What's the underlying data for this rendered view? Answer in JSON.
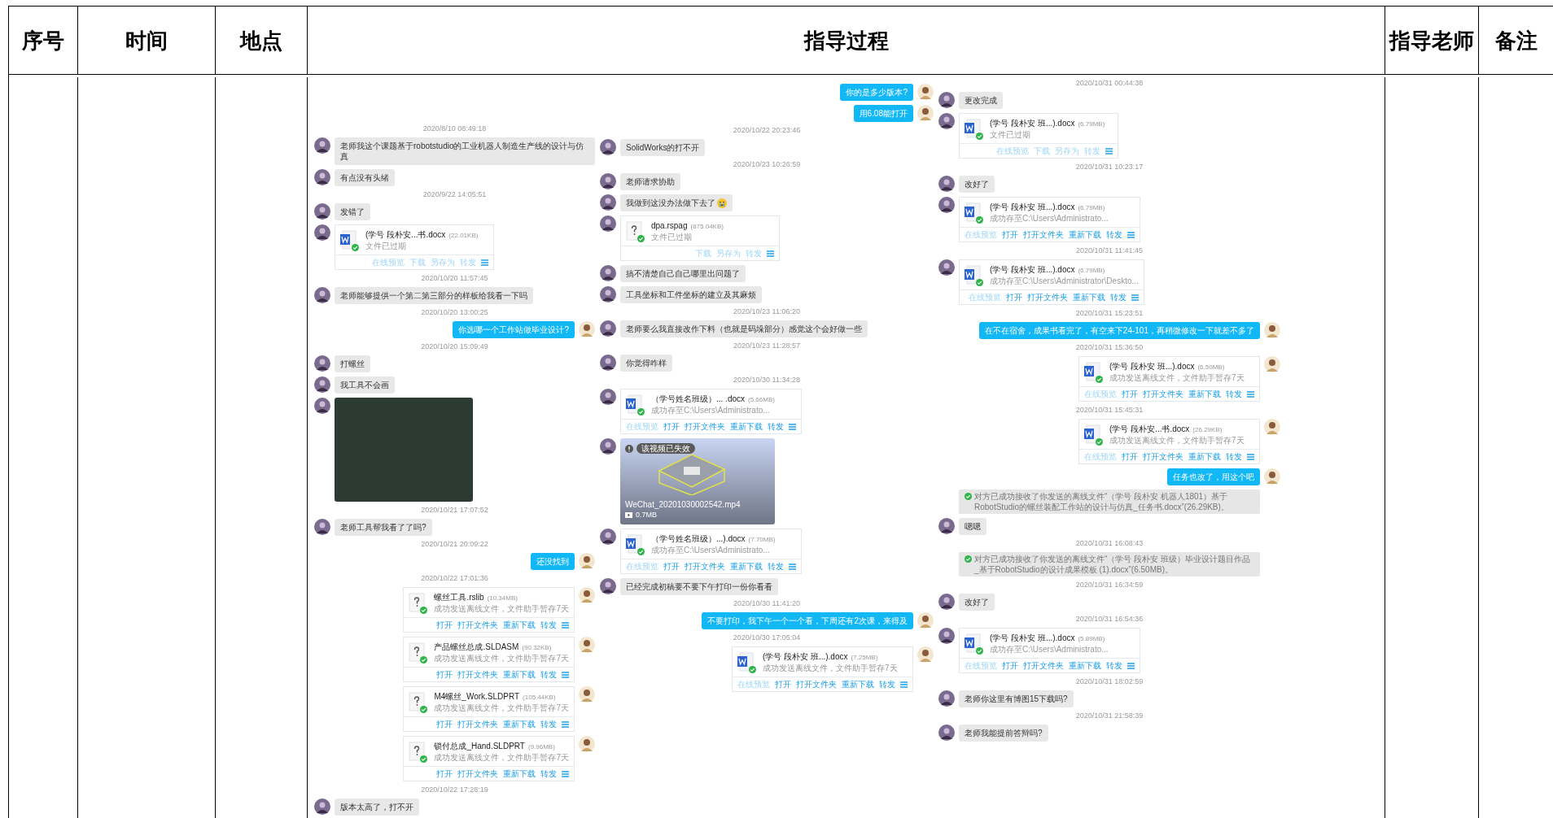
{
  "table": {
    "columns": [
      "序号",
      "时间",
      "地点",
      "指导过程",
      "指导老师",
      "备注"
    ]
  },
  "chat_panels": [
    {
      "messages": [
        {
          "kind": "time",
          "text": "2020/8/10 08:49:18"
        },
        {
          "kind": "received_text",
          "text": "老师我这个课题基于robotstudio的工业机器人制造生产线的设计与仿真"
        },
        {
          "kind": "received_text",
          "text": "有点没有头绪"
        },
        {
          "kind": "time",
          "text": "2020/9/22 14:05:51"
        },
        {
          "kind": "received_text",
          "text": "发错了"
        },
        {
          "kind": "received_word_file",
          "name": "(学号 段朴安...书.docx",
          "size": "(22.01KB)",
          "status": "文件已过期",
          "actions": [
            {
              "label": "在线预览",
              "disabled": true
            },
            {
              "label": "下载",
              "disabled": true
            },
            {
              "label": "另存为",
              "disabled": true
            },
            {
              "label": "转发",
              "disabled": true
            }
          ]
        },
        {
          "kind": "time",
          "text": "2020/10/20 11:57:45"
        },
        {
          "kind": "received_text",
          "text": "老师能够提供一个第二第三部分的样板给我看一下吗"
        },
        {
          "kind": "time",
          "text": "2020/10/20 13:00:25"
        },
        {
          "kind": "sent_text",
          "text": "你选哪一个工作站做毕业设计?"
        },
        {
          "kind": "time",
          "text": "2020/10/20 15:09:49"
        },
        {
          "kind": "received_text",
          "text": "打螺丝"
        },
        {
          "kind": "received_text",
          "text": "我工具不会画"
        },
        {
          "kind": "received_image"
        },
        {
          "kind": "time",
          "text": "2020/10/21 17:07:52"
        },
        {
          "kind": "received_text",
          "text": "老师工具帮我看了了吗?"
        },
        {
          "kind": "time",
          "text": "2020/10/21 20:09:22"
        },
        {
          "kind": "sent_text",
          "text": "还没找到"
        },
        {
          "kind": "time",
          "text": "2020/10/22 17:01:36"
        },
        {
          "kind": "sent_other_file",
          "name": "螺丝工具.rslib",
          "size": "(10.34MB)",
          "status": "成功发送离线文件，文件助手暂存7天",
          "actions": [
            {
              "label": "打开",
              "disabled": false
            },
            {
              "label": "打开文件夹",
              "disabled": false
            },
            {
              "label": "重新下载",
              "disabled": false
            },
            {
              "label": "转发",
              "disabled": false
            }
          ]
        },
        {
          "kind": "sent_other_file",
          "name": "产品螺丝总成.SLDASM",
          "size": "(90.32KB)",
          "status": "成功发送离线文件，文件助手暂存7天",
          "actions": [
            {
              "label": "打开",
              "disabled": false
            },
            {
              "label": "打开文件夹",
              "disabled": false
            },
            {
              "label": "重新下载",
              "disabled": false
            },
            {
              "label": "转发",
              "disabled": false
            }
          ]
        },
        {
          "kind": "sent_other_file",
          "name": "M4螺丝_Work.SLDPRT",
          "size": "(105.44KB)",
          "status": "成功发送离线文件，文件助手暂存7天",
          "actions": [
            {
              "label": "打开",
              "disabled": false
            },
            {
              "label": "打开文件夹",
              "disabled": false
            },
            {
              "label": "重新下载",
              "disabled": false
            },
            {
              "label": "转发",
              "disabled": false
            }
          ]
        },
        {
          "kind": "sent_other_file",
          "name": "锁付总成_Hand.SLDPRT",
          "size": "(9.96MB)",
          "status": "成功发送离线文件，文件助手暂存7天",
          "actions": [
            {
              "label": "打开",
              "disabled": false
            },
            {
              "label": "打开文件夹",
              "disabled": false
            },
            {
              "label": "重新下载",
              "disabled": false
            },
            {
              "label": "转发",
              "disabled": false
            }
          ]
        },
        {
          "kind": "time",
          "text": "2020/10/22 17:28:19"
        },
        {
          "kind": "received_text",
          "text": "版本太高了，打不开"
        }
      ]
    },
    {
      "messages": [
        {
          "kind": "sent_text",
          "text": "你的是多少版本?"
        },
        {
          "kind": "sent_text",
          "text": "用6.08能打开"
        },
        {
          "kind": "time",
          "text": "2020/10/22 20:23:46"
        },
        {
          "kind": "received_text",
          "text": "SolidWorks的打不开"
        },
        {
          "kind": "time",
          "text": "2020/10/23 10:26:59"
        },
        {
          "kind": "received_text",
          "text": "老师请求协助"
        },
        {
          "kind": "received_text",
          "text": "我做到这没办法做下去了",
          "emoji": true
        },
        {
          "kind": "received_other_file",
          "name": "dpa.rspag",
          "size": "(875.04KB)",
          "status": "文件已过期",
          "actions": [
            {
              "label": "下载",
              "disabled": true
            },
            {
              "label": "另存为",
              "disabled": true
            },
            {
              "label": "转发",
              "disabled": true
            }
          ]
        },
        {
          "kind": "received_text",
          "text": "搞不清楚自己自己哪里出问题了"
        },
        {
          "kind": "received_text",
          "text": "工具坐标和工件坐标的建立及其麻烦"
        },
        {
          "kind": "time",
          "text": "2020/10/23 11:06:20"
        },
        {
          "kind": "received_text",
          "text": "老师要么我直接改作下料（也就是码垛部分）感觉这个会好做一些"
        },
        {
          "kind": "time",
          "text": "2020/10/23 11:28:57"
        },
        {
          "kind": "received_text",
          "text": "你觉得咋样"
        },
        {
          "kind": "time",
          "text": "2020/10/30 11:34:28"
        },
        {
          "kind": "received_word_file",
          "name": "（学号姓名班级）... .docx",
          "size": "(5.66MB)",
          "status": "成功存至C:\\Users\\Administrato...",
          "actions": [
            {
              "label": "在线预览",
              "disabled": true
            },
            {
              "label": "打开",
              "disabled": false
            },
            {
              "label": "打开文件夹",
              "disabled": false
            },
            {
              "label": "重新下载",
              "disabled": false
            },
            {
              "label": "转发",
              "disabled": false
            }
          ]
        },
        {
          "kind": "received_video",
          "badge": "该视频已失效",
          "name": "WeChat_20201030002542.mp4",
          "size": "0.7MB"
        },
        {
          "kind": "received_word_file",
          "name": "（学号姓名班级）...).docx",
          "size": "(7.70MB)",
          "status": "成功存至C:\\Users\\Administrato...",
          "actions": [
            {
              "label": "在线预览",
              "disabled": true
            },
            {
              "label": "打开",
              "disabled": false
            },
            {
              "label": "打开文件夹",
              "disabled": false
            },
            {
              "label": "重新下载",
              "disabled": false
            },
            {
              "label": "转发",
              "disabled": false
            }
          ]
        },
        {
          "kind": "received_text",
          "text": "已经完成初稿要不要下午打印一份你看看"
        },
        {
          "kind": "time",
          "text": "2020/10/30 11:41:20"
        },
        {
          "kind": "sent_text",
          "text": "不要打印，我下午一个一个看，下周还有2次课，来得及"
        },
        {
          "kind": "time",
          "text": "2020/10/30 17:05:04"
        },
        {
          "kind": "sent_word_file",
          "name": "(学号 段朴安 班...).docx",
          "size": "(7.25MB)",
          "status": "成功发送离线文件，文件助手暂存7天",
          "actions": [
            {
              "label": "在线预览",
              "disabled": true
            },
            {
              "label": "打开",
              "disabled": false
            },
            {
              "label": "打开文件夹",
              "disabled": false
            },
            {
              "label": "重新下载",
              "disabled": false
            },
            {
              "label": "转发",
              "disabled": false
            }
          ]
        }
      ]
    },
    {
      "messages": [
        {
          "kind": "time",
          "text": "2020/10/31 00:44:38"
        },
        {
          "kind": "received_text",
          "text": "更改完成"
        },
        {
          "kind": "received_word_file",
          "name": "(学号 段朴安 班...).docx",
          "size": "(6.79MB)",
          "status": "文件已过期",
          "actions": [
            {
              "label": "在线预览",
              "disabled": true
            },
            {
              "label": "下载",
              "disabled": true
            },
            {
              "label": "另存为",
              "disabled": true
            },
            {
              "label": "转发",
              "disabled": true
            }
          ]
        },
        {
          "kind": "time",
          "text": "2020/10/31 10:23:17"
        },
        {
          "kind": "received_text",
          "text": "改好了"
        },
        {
          "kind": "received_word_file",
          "name": "(学号 段朴安 班...).docx",
          "size": "(6.79MB)",
          "status": "成功存至C:\\Users\\Administrato...",
          "actions": [
            {
              "label": "在线预览",
              "disabled": true
            },
            {
              "label": "打开",
              "disabled": false
            },
            {
              "label": "打开文件夹",
              "disabled": false
            },
            {
              "label": "重新下载",
              "disabled": false
            },
            {
              "label": "转发",
              "disabled": false
            }
          ]
        },
        {
          "kind": "time",
          "text": "2020/10/31 11:41:45"
        },
        {
          "kind": "received_word_file",
          "name": "(学号 段朴安 班...).docx",
          "size": "(6.79MB)",
          "status": "成功存至C:\\Users\\Administrator\\Deskto...",
          "actions": [
            {
              "label": "在线预览",
              "disabled": true
            },
            {
              "label": "打开",
              "disabled": false
            },
            {
              "label": "打开文件夹",
              "disabled": false
            },
            {
              "label": "重新下载",
              "disabled": false
            },
            {
              "label": "转发",
              "disabled": false
            }
          ]
        },
        {
          "kind": "time",
          "text": "2020/10/31 15:23:51"
        },
        {
          "kind": "sent_text",
          "text": "在不在宿舍，成果书看完了，有空来下24-101，再稍微修改一下就差不多了"
        },
        {
          "kind": "time",
          "text": "2020/10/31 15:36:50"
        },
        {
          "kind": "sent_word_file",
          "name": "(学号 段朴安 班...).docx",
          "size": "(6.50MB)",
          "status": "成功发送离线文件，文件助手暂存7天",
          "actions": [
            {
              "label": "在线预览",
              "disabled": true
            },
            {
              "label": "打开",
              "disabled": false
            },
            {
              "label": "打开文件夹",
              "disabled": false
            },
            {
              "label": "重新下载",
              "disabled": false
            },
            {
              "label": "转发",
              "disabled": false
            }
          ]
        },
        {
          "kind": "time",
          "text": "2020/10/31 15:45:31"
        },
        {
          "kind": "sent_word_file",
          "name": "(学号 段朴安...书.docx",
          "size": "(26.29KB)",
          "status": "成功发送离线文件，文件助手暂存7天",
          "actions": [
            {
              "label": "在线预览",
              "disabled": true
            },
            {
              "label": "打开",
              "disabled": false
            },
            {
              "label": "打开文件夹",
              "disabled": false
            },
            {
              "label": "重新下载",
              "disabled": false
            },
            {
              "label": "转发",
              "disabled": false
            }
          ]
        },
        {
          "kind": "sent_text",
          "text": "任务也改了，用这个吧"
        },
        {
          "kind": "notice",
          "text": "对方已成功接收了你发送的离线文件“（学号 段朴安 机器人1801）基于RobotStudio的螺丝装配工作站的设计与仿真_任务书.docx”(26.29KB)。"
        },
        {
          "kind": "received_text",
          "text": "嗯嗯"
        },
        {
          "kind": "time",
          "text": "2020/10/31 16:08:43"
        },
        {
          "kind": "notice",
          "text": "对方已成功接收了你发送的离线文件“（学号 段朴安 班级）毕业设计题目作品_基于RobotStudio的设计成果模板 (1).docx”(6.50MB)。"
        },
        {
          "kind": "time",
          "text": "2020/10/31 16:34:59"
        },
        {
          "kind": "received_text",
          "text": "改好了"
        },
        {
          "kind": "time",
          "text": "2020/10/31 16:54:36"
        },
        {
          "kind": "received_word_file",
          "name": "(学号 段朴安 班...).docx",
          "size": "(5.89MB)",
          "status": "成功存至C:\\Users\\Administrato...",
          "actions": [
            {
              "label": "在线预览",
              "disabled": true
            },
            {
              "label": "打开",
              "disabled": false
            },
            {
              "label": "打开文件夹",
              "disabled": false
            },
            {
              "label": "重新下载",
              "disabled": false
            },
            {
              "label": "转发",
              "disabled": false
            }
          ]
        },
        {
          "kind": "time",
          "text": "2020/10/31 18:02:59"
        },
        {
          "kind": "received_text",
          "text": "老师你这里有博图15下载吗?"
        },
        {
          "kind": "time",
          "text": "2020/10/31 21:58:39"
        },
        {
          "kind": "received_text",
          "text": "老师我能提前答辩吗?"
        }
      ]
    }
  ]
}
